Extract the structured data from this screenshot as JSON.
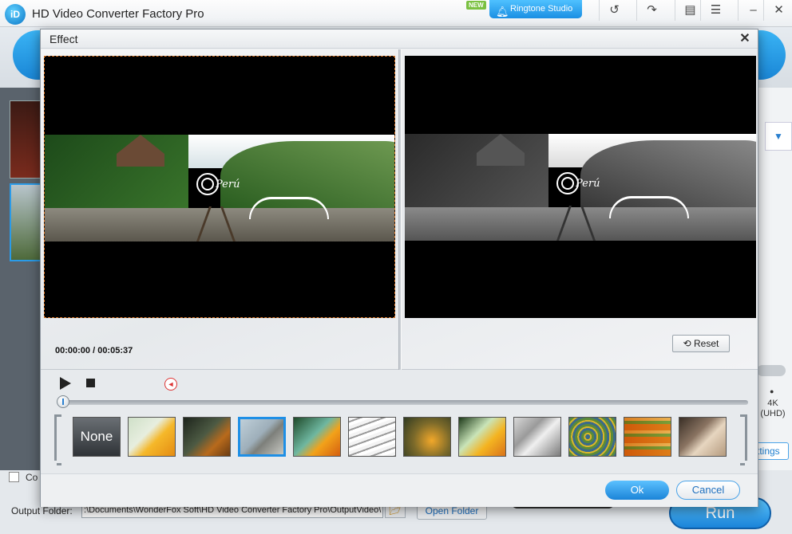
{
  "app": {
    "title": "HD Video Converter Factory Pro",
    "logo_text": "iD",
    "new_badge": "NEW",
    "ringtone_label": "Ringtone Studio",
    "toolbar_icons": [
      "undo-icon",
      "redo-icon",
      "chat-icon",
      "register-icon",
      "minimize-icon",
      "close-icon"
    ]
  },
  "background": {
    "resolution_label": "4K\n(UHD)",
    "settings_label": "ttings",
    "combine_label": "Co",
    "output_folder_label": "Output Folder:",
    "output_path": ":\\Documents\\WonderFox Soft\\HD Video Converter Factory Pro\\OutputVideo\\",
    "open_folder_label": "Open Folder",
    "run_label": "Run"
  },
  "dialog": {
    "title": "Effect",
    "timecode": "00:00:00 / 00:05:37",
    "reset_label": "Reset",
    "ok_label": "Ok",
    "cancel_label": "Cancel",
    "video_watermark": "Perú",
    "seek_position": 0,
    "filters": [
      {
        "name": "none",
        "label": "None",
        "selected": false
      },
      {
        "name": "filter-1",
        "selected": false
      },
      {
        "name": "filter-2",
        "selected": false
      },
      {
        "name": "filter-3",
        "selected": true
      },
      {
        "name": "filter-4",
        "selected": false
      },
      {
        "name": "filter-5",
        "selected": false
      },
      {
        "name": "filter-6",
        "selected": false
      },
      {
        "name": "filter-7",
        "selected": false
      },
      {
        "name": "filter-8",
        "selected": false
      },
      {
        "name": "filter-9",
        "selected": false
      },
      {
        "name": "filter-10",
        "selected": false
      },
      {
        "name": "filter-11",
        "selected": false
      }
    ]
  },
  "colors": {
    "accent": "#1e8fe6",
    "selection_border": "#e07a2a"
  }
}
